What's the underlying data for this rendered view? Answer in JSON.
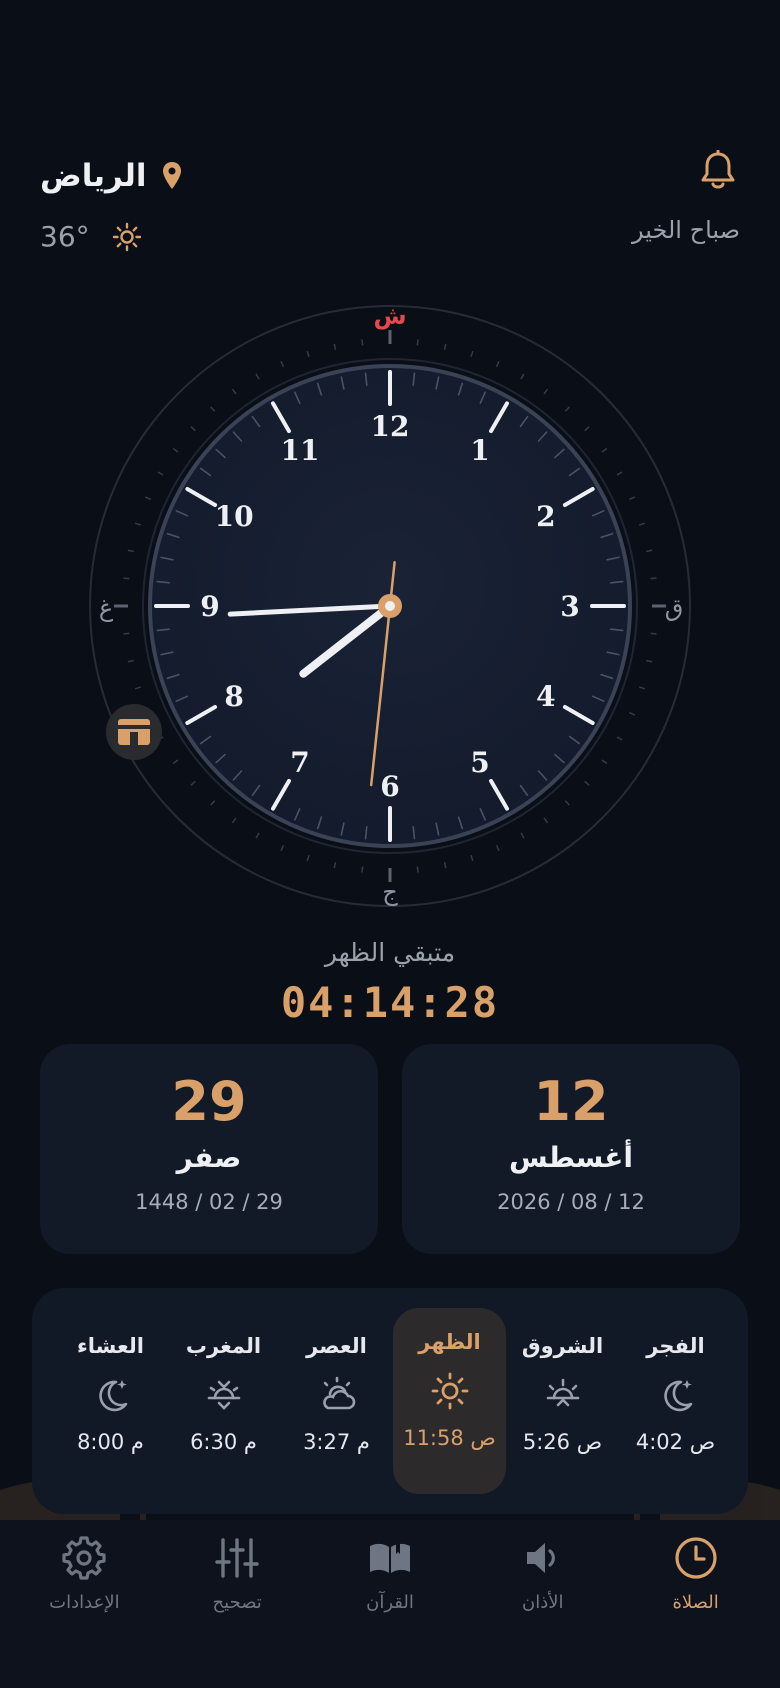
{
  "header": {
    "city": "الرياض",
    "temperature": "36°",
    "greeting": "صباح الخير"
  },
  "clock": {
    "numbers": [
      "12",
      "1",
      "2",
      "3",
      "4",
      "5",
      "6",
      "7",
      "8",
      "9",
      "10",
      "11"
    ],
    "markers": {
      "top": "ش",
      "right": "ق",
      "bottom": "ج",
      "left": "غ"
    },
    "time": {
      "hour": 7,
      "minute": 44,
      "second": 31
    }
  },
  "countdown": {
    "label": "متبقي الظهر",
    "value": "04:14:28"
  },
  "hijri_card": {
    "day": "29",
    "month": "صفر",
    "full": "1448 / 02 / 29"
  },
  "gregorian_card": {
    "day": "12",
    "month": "أغسطس",
    "full": "2026 / 08 / 12"
  },
  "prayers": [
    {
      "name": "الفجر",
      "time": "4:02 ص",
      "icon": "moon-star-icon",
      "active": false
    },
    {
      "name": "الشروق",
      "time": "5:26 ص",
      "icon": "sunrise-icon",
      "active": false
    },
    {
      "name": "الظهر",
      "time": "11:58 ص",
      "icon": "sun-icon",
      "active": true
    },
    {
      "name": "العصر",
      "time": "3:27 م",
      "icon": "sun-cloud-icon",
      "active": false
    },
    {
      "name": "المغرب",
      "time": "6:30 م",
      "icon": "sunset-icon",
      "active": false
    },
    {
      "name": "العشاء",
      "time": "8:00 م",
      "icon": "moon-star-icon",
      "active": false
    }
  ],
  "nav": [
    {
      "label": "الصلاة",
      "icon": "clock-icon",
      "active": true
    },
    {
      "label": "الأذان",
      "icon": "speaker-icon",
      "active": false
    },
    {
      "label": "القرآن",
      "icon": "book-icon",
      "active": false
    },
    {
      "label": "تصحيح",
      "icon": "sliders-icon",
      "active": false
    },
    {
      "label": "الإعدادات",
      "icon": "gear-icon",
      "active": false
    }
  ],
  "colors": {
    "accent": "#d9a06a",
    "background": "#0a0e17",
    "card": "#121a28",
    "marker_red": "#e5484d"
  }
}
